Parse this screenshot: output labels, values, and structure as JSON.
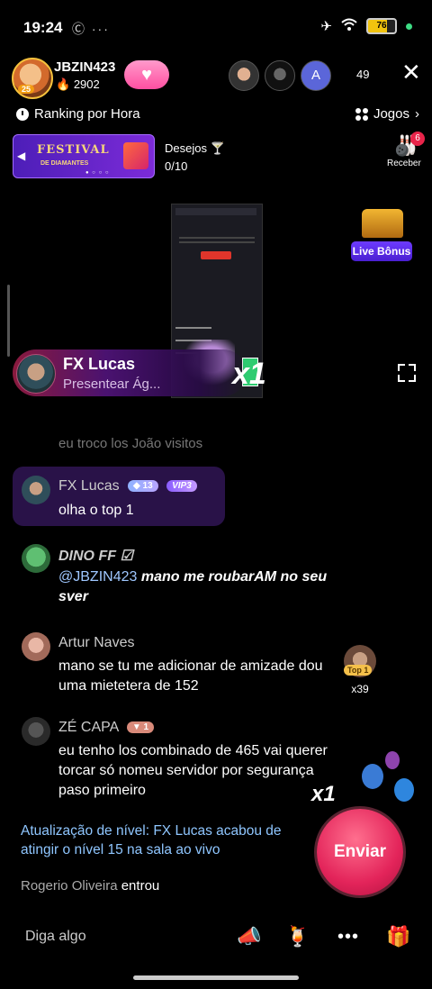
{
  "status_bar": {
    "time": "19:24",
    "left_icons": "Ⓒ ···",
    "battery": "76"
  },
  "host": {
    "name": "JBZIN423",
    "score": "2902",
    "level": "25"
  },
  "viewers": {
    "third_initial": "A",
    "count": "49"
  },
  "ranking": {
    "label": "Ranking por Hora"
  },
  "jogos": {
    "label": "Jogos"
  },
  "festival": {
    "title": "FESTIVAL",
    "subtitle": "DE DIAMANTES"
  },
  "desejos": {
    "label": "Desejos",
    "progress": "0/10"
  },
  "receber": {
    "label": "Receber",
    "badge": "6"
  },
  "live_bonus": {
    "label": "Live Bônus"
  },
  "gift_banner": {
    "name": "FX Lucas",
    "subtitle": "Presentear Ág...",
    "multiplier": "x1"
  },
  "chat": {
    "faded": "eu troco los João visitos",
    "messages": [
      {
        "name": "FX Lucas",
        "level": "13",
        "vip": "VIP3",
        "text": "olha o top 1"
      },
      {
        "name": "DINO FF ☑",
        "mention": "@JBZIN423",
        "text": "mano me roubarAM no seu sver"
      },
      {
        "name": "Artur Naves",
        "text": "mano se tu me adicionar de amizade dou uma mietetera de 152"
      },
      {
        "name": "ZÉ CAPA",
        "level": "1",
        "text": "eu tenho los combinado de 465 vai querer torcar só nomeu servidor por segurança paso primeiro"
      }
    ],
    "nivel": "Atualização de nível: FX Lucas acabou de atingir o nível 15 na sala ao vivo",
    "entrou_name": "Rogerio Oliveira",
    "entrou_action": "entrou"
  },
  "top1": {
    "tag": "Top 1",
    "count": "x39"
  },
  "float_gift": {
    "multiplier": "x1"
  },
  "enviar": {
    "label": "Enviar"
  },
  "input": {
    "placeholder": "Diga algo"
  }
}
